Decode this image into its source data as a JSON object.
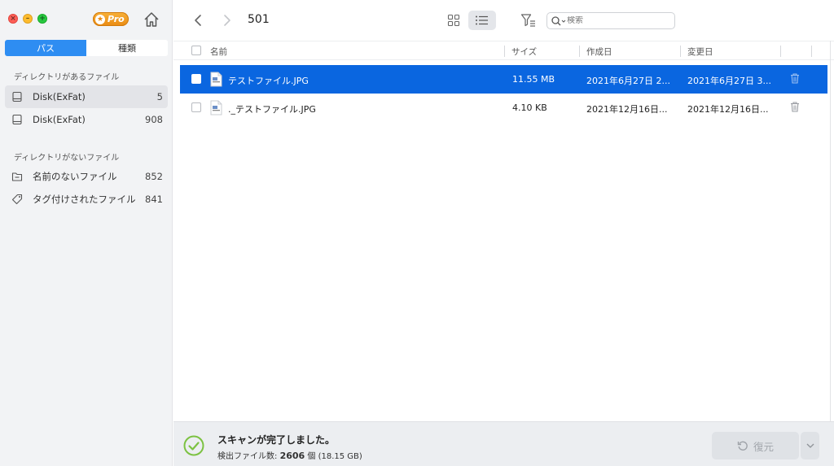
{
  "sidebar": {
    "pro_label": "Pro",
    "segments": {
      "path": "パス",
      "type": "種類"
    },
    "sections": [
      {
        "heading": "ディレクトリがあるファイル",
        "items": [
          {
            "icon": "drive-icon",
            "label": "Disk(ExFat)",
            "count": "5",
            "selected": true
          },
          {
            "icon": "drive-icon",
            "label": "Disk(ExFat)",
            "count": "908",
            "selected": false
          }
        ]
      },
      {
        "heading": "ディレクトリがないファイル",
        "items": [
          {
            "icon": "folder-icon",
            "label": "名前のないファイル",
            "count": "852",
            "selected": false
          },
          {
            "icon": "tag-icon",
            "label": "タグ付けされたファイル",
            "count": "841",
            "selected": false
          }
        ]
      }
    ]
  },
  "toolbar": {
    "breadcrumb": "501",
    "search_placeholder": "検索"
  },
  "table": {
    "headers": {
      "name": "名前",
      "size": "サイズ",
      "created": "作成日",
      "modified": "変更日"
    },
    "rows": [
      {
        "name": "テストファイル.JPG",
        "size": "11.55 MB",
        "created": "2021年6月27日 2...",
        "modified": "2021年6月27日 3...",
        "selected": true
      },
      {
        "name": "._テストファイル.JPG",
        "size": "4.10 KB",
        "created": "2021年12月16日...",
        "modified": "2021年12月16日...",
        "selected": false
      }
    ]
  },
  "footer": {
    "status_title": "スキャンが完了しました。",
    "found_label": "検出ファイル数:",
    "found_count": "2606",
    "found_unit": "個",
    "found_size": "(18.15 GB)",
    "recover_label": "復元"
  },
  "colors": {
    "accent": "#2e8df2",
    "selection": "#0a66e0",
    "success": "#7cc242"
  }
}
